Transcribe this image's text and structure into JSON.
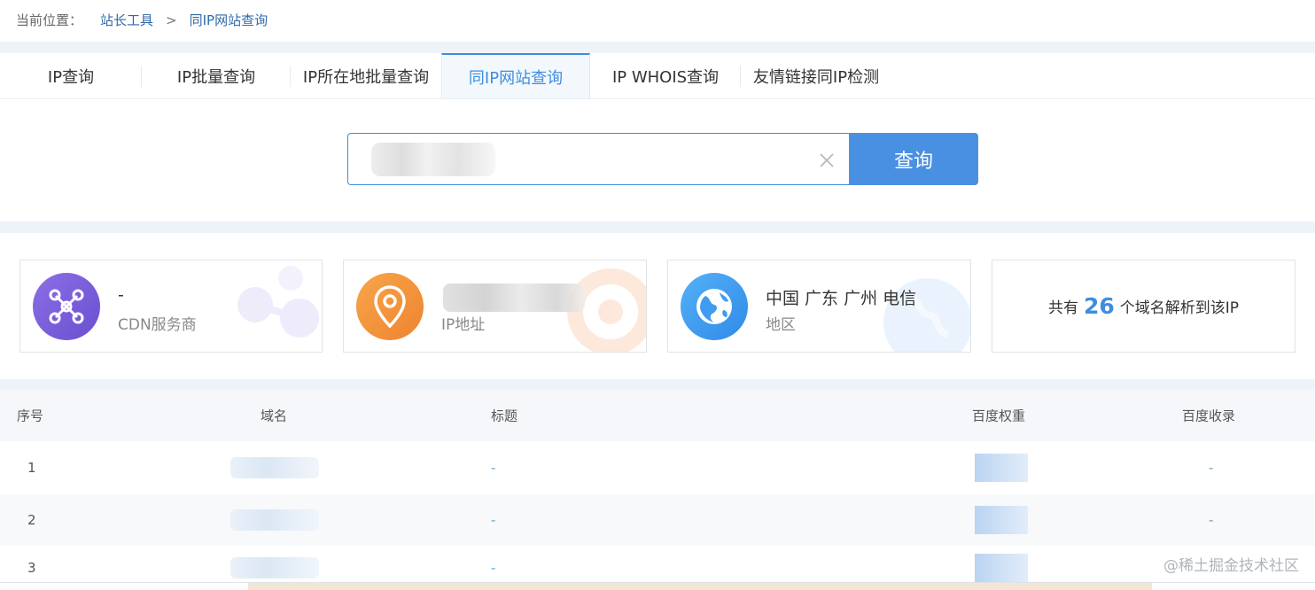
{
  "breadcrumb": {
    "label": "当前位置：",
    "root": "站长工具",
    "separator": ">",
    "current": "同IP网站查询"
  },
  "tabs": [
    {
      "label": "IP查询",
      "active": false
    },
    {
      "label": "IP批量查询",
      "active": false
    },
    {
      "label": "IP所在地批量查询",
      "active": false
    },
    {
      "label": "同IP网站查询",
      "active": true
    },
    {
      "label": "IP WHOIS查询",
      "active": false
    },
    {
      "label": "友情链接同IP检测",
      "active": false
    }
  ],
  "search": {
    "value": "",
    "button_label": "查询"
  },
  "cards": {
    "cdn": {
      "value": "-",
      "caption": "CDN服务商",
      "icon": "network-icon",
      "color": "#7b5ed8"
    },
    "ip": {
      "caption": "IP地址",
      "icon": "location-pin-icon",
      "color": "#f3923a"
    },
    "region": {
      "value": "中国 广东 广州 电信",
      "caption": "地区",
      "icon": "globe-icon",
      "color": "#3f9cf0"
    },
    "count": {
      "prefix": "共有",
      "number": "26",
      "suffix": "个域名解析到该IP"
    }
  },
  "table": {
    "headers": {
      "index": "序号",
      "domain": "域名",
      "title": "标题",
      "baidu_rank": "百度权重",
      "baidu_index": "百度收录"
    },
    "rows": [
      {
        "index": "1",
        "title": "-",
        "baidu_index": "-"
      },
      {
        "index": "2",
        "title": "-",
        "baidu_index": "-"
      },
      {
        "index": "3",
        "title": "-",
        "baidu_index": ""
      }
    ]
  },
  "watermark": "@稀土掘金技术社区",
  "colors": {
    "accent": "#3d8de0",
    "button": "#4a90e2"
  }
}
